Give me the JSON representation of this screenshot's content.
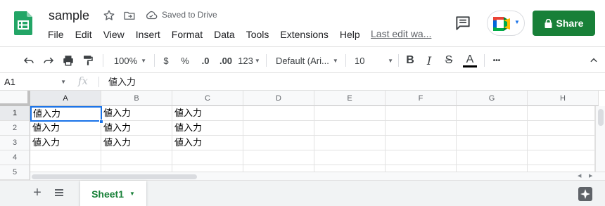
{
  "header": {
    "title": "sample",
    "saved_status": "Saved to Drive",
    "last_edit": "Last edit wa...",
    "share_label": "Share",
    "share_color": "#188038",
    "icons": [
      "sheets-logo-icon",
      "star-icon",
      "move-folder-icon",
      "cloud-done-icon",
      "comments-icon",
      "meet-icon",
      "lock-icon"
    ]
  },
  "menu": [
    "File",
    "Edit",
    "View",
    "Insert",
    "Format",
    "Data",
    "Tools",
    "Extensions",
    "Help"
  ],
  "toolbar": {
    "zoom": "100%",
    "currency": "$",
    "percent": "%",
    "decrease_decimal": ".0",
    "increase_decimal": ".00",
    "more_formats": "123",
    "font": "Default (Ari...",
    "font_size": "10",
    "bold": "B",
    "italic": "I",
    "strikethrough": "S",
    "text_color": "A",
    "more": "•••"
  },
  "formula_bar": {
    "cell_ref": "A1",
    "fx": "fx",
    "content": "値入力"
  },
  "grid": {
    "columns": [
      "A",
      "B",
      "C",
      "D",
      "E",
      "F",
      "G",
      "H"
    ],
    "rows": [
      "1",
      "2",
      "3",
      "4",
      "5"
    ],
    "cells": [
      [
        "値入力",
        "値入力",
        "値入力",
        "",
        "",
        "",
        "",
        ""
      ],
      [
        "値入力",
        "値入力",
        "値入力",
        "",
        "",
        "",
        "",
        ""
      ],
      [
        "値入力",
        "値入力",
        "値入力",
        "",
        "",
        "",
        "",
        ""
      ],
      [
        "",
        "",
        "",
        "",
        "",
        "",
        "",
        ""
      ],
      [
        "",
        "",
        "",
        "",
        "",
        "",
        "",
        ""
      ]
    ],
    "active_cell": "A1",
    "selection_color": "#1a73e8"
  },
  "sheets": {
    "tabs": [
      {
        "label": "Sheet1",
        "active": true
      }
    ],
    "accent": "#188038"
  }
}
